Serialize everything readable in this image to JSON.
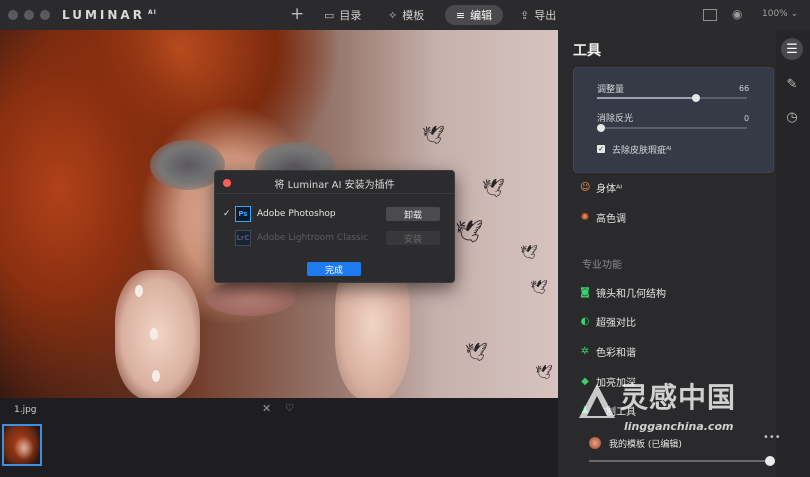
{
  "app": {
    "logo": "LUMINAR",
    "logo_suffix": "AI"
  },
  "topbar": {
    "nav": {
      "catalog": "目录",
      "templates": "模板",
      "edit": "编辑",
      "export": "导出"
    },
    "zoom": "100%",
    "icons": [
      "plus-icon",
      "folder-icon",
      "magic-wand-icon",
      "sliders-icon",
      "share-icon",
      "compare-icon",
      "eye-icon"
    ]
  },
  "dialog": {
    "title": "将 Luminar AI 安装为插件",
    "rows": [
      {
        "icon": "Ps",
        "checked": true,
        "name": "Adobe Photoshop",
        "action": "卸载",
        "enabled": true
      },
      {
        "icon": "LrC",
        "checked": false,
        "name": "Adobe Lightroom Classic",
        "action": "安装",
        "enabled": false
      }
    ],
    "done": "完成"
  },
  "filmstrip": {
    "filename": "1.jpg"
  },
  "panel": {
    "title": "工具",
    "sliders": [
      {
        "label": "调整量",
        "value": "66",
        "level": 0.66
      },
      {
        "label": "消除反光",
        "value": "0",
        "level": 0
      }
    ],
    "checkbox": {
      "label": "去除皮肤瑕疵",
      "badge": "ᴬᴵ",
      "checked": true
    },
    "tools": [
      {
        "icon": "body-icon",
        "label": "身体",
        "badge": "ᴬᴵ",
        "color": "#ff9a3c"
      },
      {
        "icon": "sun-icon",
        "label": "高色调",
        "color": "#ff7a3c"
      }
    ],
    "pro_section": "专业功能",
    "pro_tools": [
      {
        "icon": "camera-icon",
        "label": "镜头和几何结构",
        "color": "#3ad06a"
      },
      {
        "icon": "contrast-icon",
        "label": "超强对比",
        "color": "#3ad06a"
      },
      {
        "icon": "gear-icon",
        "label": "色彩和谐",
        "color": "#3ad06a"
      },
      {
        "icon": "drop-icon",
        "label": "加亮加深",
        "color": "#3ad06a"
      },
      {
        "icon": "stamp-icon",
        "label": "仿制工具",
        "color": "#3ad06a"
      }
    ],
    "template": {
      "name": "我的模板 (已编辑)",
      "more": "•••"
    }
  },
  "watermark": {
    "text": "灵感中国",
    "url": "lingganchina.com"
  }
}
